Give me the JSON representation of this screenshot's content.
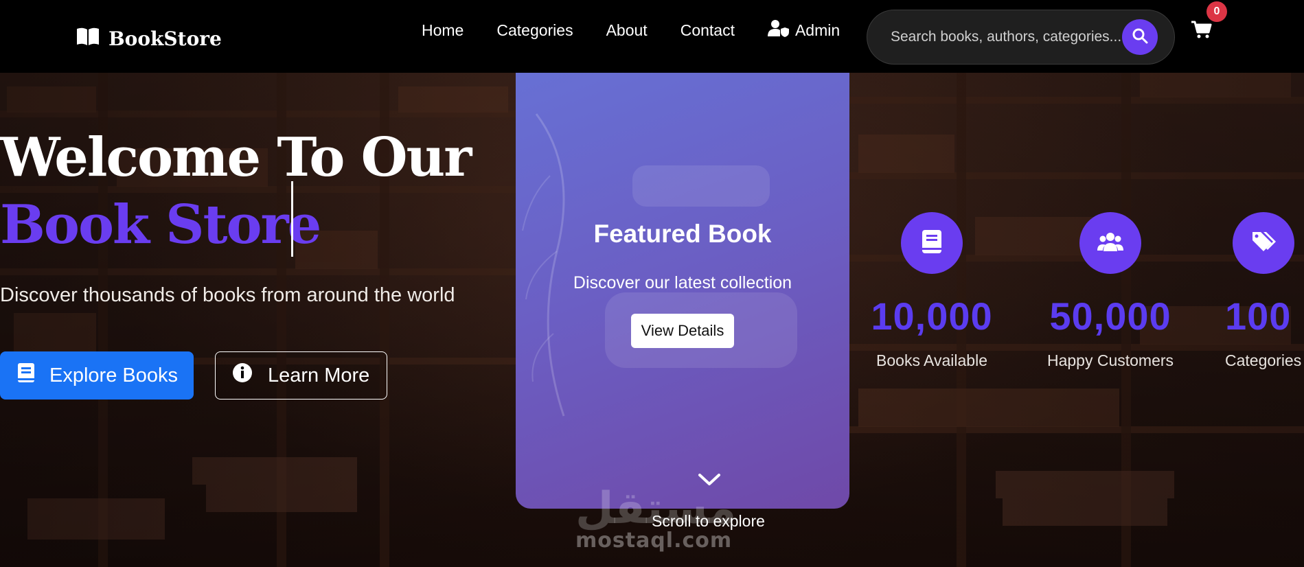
{
  "navbar": {
    "brand": "BookStore",
    "links": [
      "Home",
      "Categories",
      "About",
      "Contact"
    ],
    "admin_label": "Admin",
    "search_placeholder": "Search books, authors, categories...",
    "cart_count": "0"
  },
  "hero": {
    "title_line1": "Welcome To Our",
    "title_line2": "Book Store",
    "subtitle": "Discover thousands of books from around the world",
    "explore_label": "Explore Books",
    "learn_label": "Learn More"
  },
  "featured": {
    "title": "Featured Book",
    "subtitle": "Discover our latest collection",
    "button_label": "View Details"
  },
  "scroll_text": "Scroll to explore",
  "stats": [
    {
      "icon": "book-icon",
      "value": "10,000",
      "label": "Books Available"
    },
    {
      "icon": "users-icon",
      "value": "50,000",
      "label": "Happy Customers"
    },
    {
      "icon": "tags-icon",
      "value": "100",
      "label": "Categories"
    }
  ],
  "watermark": {
    "arabic": "مستقل",
    "latin": "mostaql.com"
  },
  "colors": {
    "accent": "#6a3df0",
    "primary_button": "#1a73f5",
    "badge": "#dc3545"
  }
}
